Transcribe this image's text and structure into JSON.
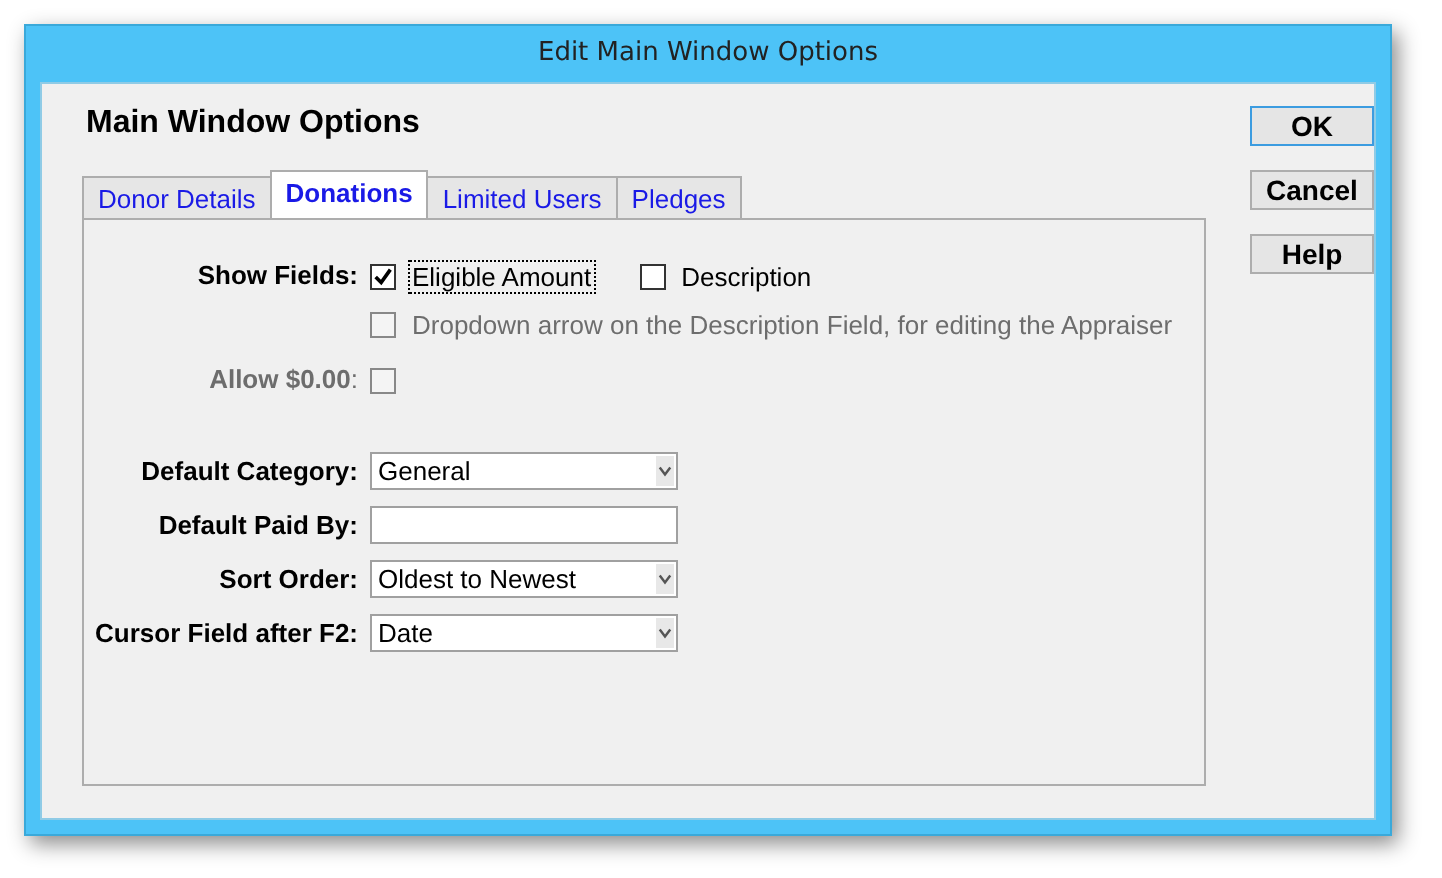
{
  "window": {
    "title": "Edit Main Window Options"
  },
  "heading": "Main Window Options",
  "tabs": [
    {
      "label": "Donor Details",
      "selected": false
    },
    {
      "label": "Donations",
      "selected": true
    },
    {
      "label": "Limited Users",
      "selected": false
    },
    {
      "label": "Pledges",
      "selected": false
    }
  ],
  "show_fields": {
    "label": "Show Fields:",
    "options": [
      {
        "label": "Eligible Amount",
        "checked": true,
        "disabled": false,
        "focused": true
      },
      {
        "label": "Description",
        "checked": false,
        "disabled": false,
        "focused": false
      }
    ],
    "extra": {
      "label": "Dropdown arrow on the Description Field, for editing the Appraiser",
      "checked": false,
      "disabled": true
    }
  },
  "allow_zero": {
    "label": "**Allow $0.00**:",
    "checked": false,
    "disabled": true
  },
  "fields": [
    {
      "kind": "dropdown",
      "label": "Default Category:",
      "value": "General"
    },
    {
      "kind": "text",
      "label": "Default Paid By:"
    },
    {
      "kind": "dropdown",
      "label": "Sort Order:",
      "value": "Oldest to Newest"
    },
    {
      "kind": "dropdown",
      "label": "Cursor Field after F2:",
      "value": "Date"
    }
  ],
  "buttons": [
    {
      "label": "OK",
      "default": true
    },
    {
      "label": "Cancel",
      "default": false
    },
    {
      "label": "Help",
      "default": false
    }
  ]
}
